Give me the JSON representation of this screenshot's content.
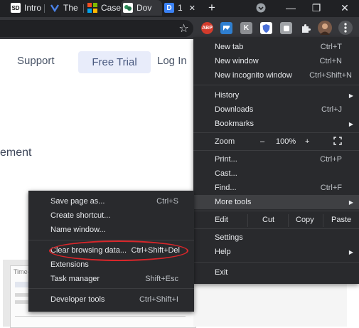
{
  "tabs": [
    {
      "title": "Intro",
      "favicon": "SD",
      "favicon_color": "#111111"
    },
    {
      "title": "The",
      "favicon": "v",
      "favicon_color": "#3b6fd8"
    },
    {
      "title": "Case",
      "favicon": "ms-logo-icon",
      "favicon_color": "#f25022"
    },
    {
      "title": "Dov",
      "favicon": "leaf-icon",
      "favicon_color": "#2d8f5b",
      "active": true
    },
    {
      "title": "1",
      "favicon": "D",
      "favicon_color": "#3b82f6"
    }
  ],
  "tab_controls": {
    "new_tab": "+",
    "close": "✕"
  },
  "window_controls": {
    "minimize": "—",
    "maximize": "❐",
    "close": "✕"
  },
  "toolbar": {
    "extensions": [
      {
        "name": "abp-icon",
        "text": "ABP",
        "color": "#d33b2c"
      },
      {
        "name": "photo-extension-icon",
        "text": "",
        "color": "#2f7fd0"
      },
      {
        "name": "k-extension-icon",
        "text": "K",
        "color": "#8d8f93"
      },
      {
        "name": "shield-extension-icon",
        "text": "",
        "color": "#4a6fd8"
      },
      {
        "name": "grammar-extension-icon",
        "text": "",
        "color": "#a0a3a7"
      }
    ]
  },
  "page": {
    "nav": {
      "support": "Support",
      "trial": "Free Trial",
      "login": "Log In"
    },
    "heading_fragment": "ement",
    "preview_caption": "Time-"
  },
  "menu": {
    "new_tab": {
      "label": "New tab",
      "shortcut": "Ctrl+T"
    },
    "new_window": {
      "label": "New window",
      "shortcut": "Ctrl+N"
    },
    "new_incognito": {
      "label": "New incognito window",
      "shortcut": "Ctrl+Shift+N"
    },
    "history": {
      "label": "History"
    },
    "downloads": {
      "label": "Downloads",
      "shortcut": "Ctrl+J"
    },
    "bookmarks": {
      "label": "Bookmarks"
    },
    "zoom": {
      "label": "Zoom",
      "minus": "–",
      "value": "100%",
      "plus": "+"
    },
    "print": {
      "label": "Print...",
      "shortcut": "Ctrl+P"
    },
    "cast": {
      "label": "Cast..."
    },
    "find": {
      "label": "Find...",
      "shortcut": "Ctrl+F"
    },
    "more_tools": {
      "label": "More tools"
    },
    "edit": {
      "label": "Edit",
      "cut": "Cut",
      "copy": "Copy",
      "paste": "Paste"
    },
    "settings": {
      "label": "Settings"
    },
    "help": {
      "label": "Help"
    },
    "exit": {
      "label": "Exit"
    }
  },
  "submenu": {
    "save_page": {
      "label": "Save page as...",
      "shortcut": "Ctrl+S"
    },
    "create_shortcut": {
      "label": "Create shortcut..."
    },
    "name_window": {
      "label": "Name window..."
    },
    "clear_browsing": {
      "label": "Clear browsing data...",
      "shortcut": "Ctrl+Shift+Del"
    },
    "extensions": {
      "label": "Extensions"
    },
    "task_manager": {
      "label": "Task manager",
      "shortcut": "Shift+Esc"
    },
    "developer_tools": {
      "label": "Developer tools",
      "shortcut": "Ctrl+Shift+I"
    }
  }
}
